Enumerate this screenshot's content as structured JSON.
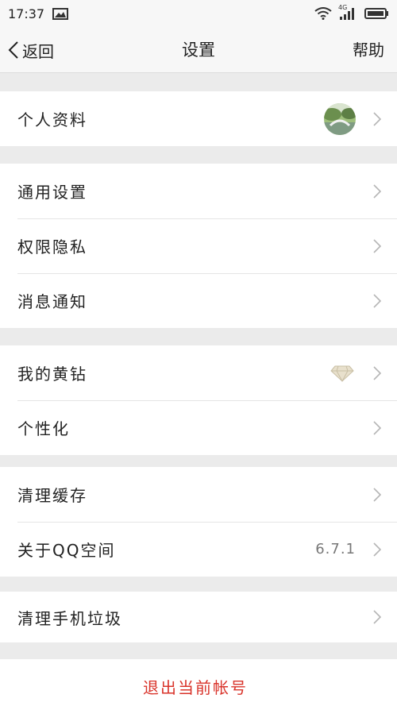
{
  "status": {
    "time": "17:37",
    "network": "4G"
  },
  "nav": {
    "back_label": "返回",
    "title": "设置",
    "help_label": "帮助"
  },
  "groups": {
    "profile": {
      "label": "个人资料"
    },
    "general": [
      {
        "label": "通用设置"
      },
      {
        "label": "权限隐私"
      },
      {
        "label": "消息通知"
      }
    ],
    "vip": [
      {
        "label": "我的黄钻"
      },
      {
        "label": "个性化"
      }
    ],
    "storage": [
      {
        "label": "清理缓存"
      },
      {
        "label": "关于QQ空间",
        "value": "6.7.1"
      }
    ],
    "phone": {
      "label": "清理手机垃圾"
    }
  },
  "logout": {
    "label": "退出当前帐号"
  },
  "icons": [
    "picture-icon",
    "wifi-icon",
    "signal-icon",
    "battery-icon",
    "back-chevron-icon",
    "chevron-right-icon",
    "diamond-icon"
  ],
  "colors": {
    "accent_red": "#d9342b",
    "background": "#ebebeb"
  }
}
